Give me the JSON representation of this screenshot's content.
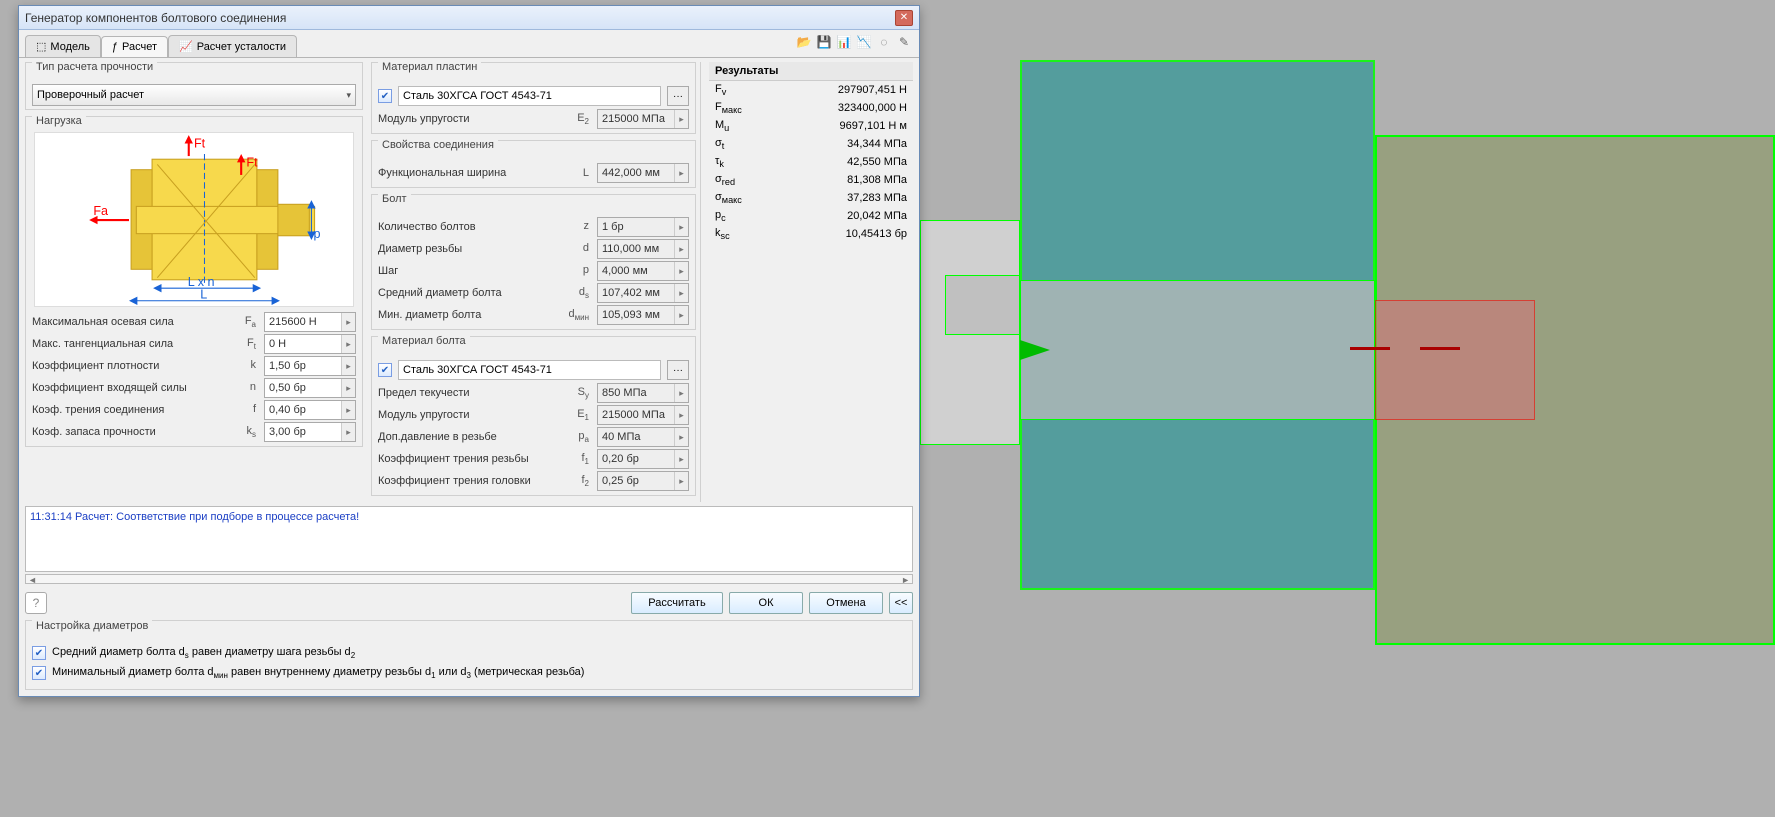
{
  "window": {
    "title": "Генератор компонентов болтового соединения"
  },
  "tabs": {
    "model": "Модель",
    "calc": "Расчет",
    "fatigue": "Расчет усталости"
  },
  "toolbar_icons": [
    "open-icon",
    "save-icon",
    "chart-icon",
    "fatigue-icon",
    "invisible-icon",
    "edit-icon"
  ],
  "calc_type": {
    "title": "Тип расчета прочности",
    "value": "Проверочный расчет"
  },
  "load": {
    "title": "Нагрузка",
    "rows": [
      {
        "label": "Максимальная осевая сила",
        "sym": "F",
        "sub": "a",
        "val": "215600 Н"
      },
      {
        "label": "Макс. тангенциальная сила",
        "sym": "F",
        "sub": "t",
        "val": "0 Н"
      },
      {
        "label": "Коэффициент плотности",
        "sym": "k",
        "sub": "",
        "val": "1,50 бр"
      },
      {
        "label": "Коэффициент входящей силы",
        "sym": "n",
        "sub": "",
        "val": "0,50 бр"
      },
      {
        "label": "Коэф. трения соединения",
        "sym": "f",
        "sub": "",
        "val": "0,40 бр"
      },
      {
        "label": "Коэф. запаса прочности",
        "sym": "k",
        "sub": "s",
        "val": "3,00 бр"
      }
    ],
    "sketch_labels": {
      "Ft1": "Ft",
      "Ft2": "Ft",
      "Fa": "Fa",
      "Lxn": "L x n",
      "L": "L",
      "p": "p"
    }
  },
  "plate_mat": {
    "title": "Материал пластин",
    "name": "Сталь 30ХГСА ГОСТ 4543-71",
    "mod": {
      "label": "Модуль упругости",
      "sym": "E",
      "sub": "2",
      "val": "215000 МПа"
    }
  },
  "conn_props": {
    "title": "Свойства соединения",
    "len": {
      "label": "Функциональная ширина",
      "sym": "L",
      "val": "442,000 мм"
    }
  },
  "bolt": {
    "title": "Болт",
    "rows": [
      {
        "label": "Количество болтов",
        "sym": "z",
        "val": "1 бр",
        "grey": true
      },
      {
        "label": "Диаметр резьбы",
        "sym": "d",
        "val": "110,000 мм",
        "grey": true
      },
      {
        "label": "Шаг",
        "sym": "p",
        "val": "4,000 мм",
        "grey": true
      },
      {
        "label": "Средний диаметр болта",
        "sym": "d",
        "sub": "s",
        "val": "107,402 мм",
        "grey": true
      },
      {
        "label": "Мин. диаметр болта",
        "sym": "d",
        "sub": "мин",
        "val": "105,093 мм",
        "grey": true
      }
    ]
  },
  "bolt_mat": {
    "title": "Материал болта",
    "name": "Сталь 30ХГСА ГОСТ 4543-71",
    "rows": [
      {
        "label": "Предел текучести",
        "sym": "S",
        "sub": "y",
        "val": "850 МПа"
      },
      {
        "label": "Модуль упругости",
        "sym": "E",
        "sub": "1",
        "val": "215000 МПа"
      },
      {
        "label": "Доп.давление в резьбе",
        "sym": "p",
        "sub": "a",
        "val": "40 МПа"
      },
      {
        "label": "Коэффициент трения резьбы",
        "sym": "f",
        "sub": "1",
        "val": "0,20 бр"
      },
      {
        "label": "Коэффициент трения головки",
        "sym": "f",
        "sub": "2",
        "val": "0,25 бр"
      }
    ]
  },
  "results": {
    "title": "Результаты",
    "rows": [
      {
        "sym": "F",
        "sub": "v",
        "val": "297907,451 Н"
      },
      {
        "sym": "F",
        "sub": "макс",
        "val": "323400,000 Н"
      },
      {
        "sym": "M",
        "sub": "u",
        "val": "9697,101 Н м"
      },
      {
        "sym": "σ",
        "sub": "t",
        "val": "34,344 МПа"
      },
      {
        "sym": "τ",
        "sub": "k",
        "val": "42,550 МПа"
      },
      {
        "sym": "σ",
        "sub": "red",
        "val": "81,308 МПа"
      },
      {
        "sym": "σ",
        "sub": "макс",
        "val": "37,283 МПа"
      },
      {
        "sym": "p",
        "sub": "c",
        "val": "20,042 МПа"
      },
      {
        "sym": "k",
        "sub": "sc",
        "val": "10,45413 бр"
      }
    ]
  },
  "log": {
    "text": "11:31:14 Расчет: Соответствие при подборе в процессе расчета!"
  },
  "buttons": {
    "calc": "Рассчитать",
    "ok": "ОК",
    "cancel": "Отмена",
    "expand": "<<"
  },
  "diam": {
    "title": "Настройка диаметров",
    "r1_a": "Средний диаметр болта d",
    "r1_b": " равен диаметру шага резьбы d",
    "r2_a": "Минимальный диаметр болта d",
    "r2_b": " равен внутреннему диаметру резьбы d",
    "r2_c": " или d",
    "r2_d": " (метрическая резьба)"
  }
}
